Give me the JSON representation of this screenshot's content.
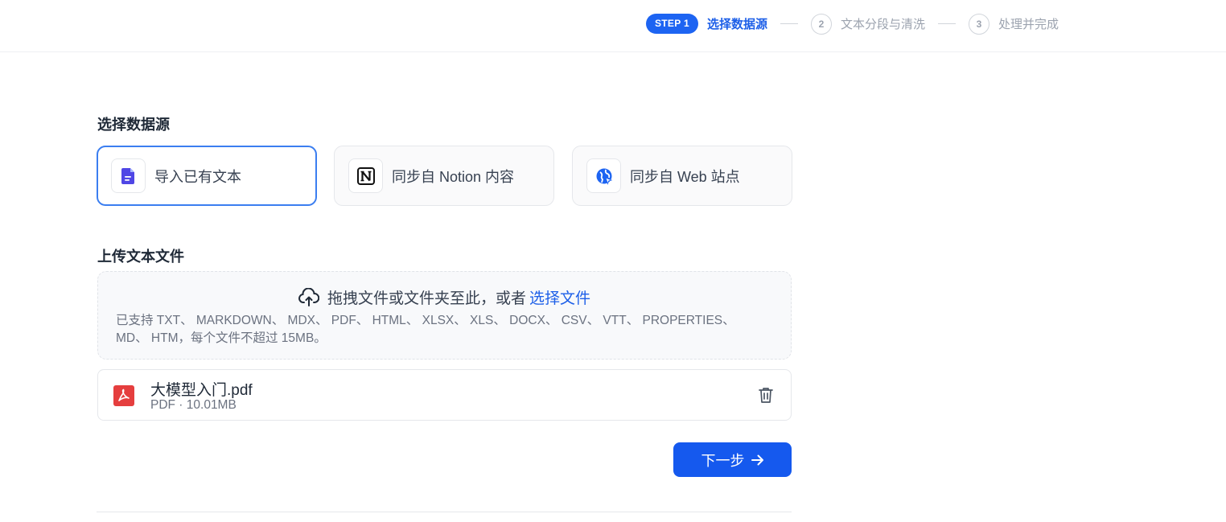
{
  "stepper": {
    "step1_badge": "STEP 1",
    "step1_label": "选择数据源",
    "step2_num": "2",
    "step2_label": "文本分段与清洗",
    "step3_num": "3",
    "step3_label": "处理并完成"
  },
  "datasource": {
    "title": "选择数据源",
    "options": [
      {
        "label": "导入已有文本",
        "icon": "document-icon",
        "selected": true
      },
      {
        "label": "同步自 Notion 内容",
        "icon": "notion-icon",
        "selected": false
      },
      {
        "label": "同步自 Web 站点",
        "icon": "web-icon",
        "selected": false
      }
    ]
  },
  "upload": {
    "title": "上传文本文件",
    "prompt": "拖拽文件或文件夹至此，或者",
    "link": "选择文件",
    "supported_line1": "已支持 TXT、 MARKDOWN、 MDX、 PDF、 HTML、 XLSX、 XLS、 DOCX、 CSV、 VTT、 PROPERTIES、",
    "supported_line2": "MD、 HTM，每个文件不超过 15MB。"
  },
  "file": {
    "name": "大模型入门.pdf",
    "meta": "PDF · 10.01MB",
    "icon": "pdf-icon"
  },
  "actions": {
    "next_label": "下一步"
  },
  "colors": {
    "primary": "#1559ee",
    "active_border": "#3b7ef0",
    "pdf_red": "#e53e3e",
    "doc_purple": "#4f46e5"
  }
}
